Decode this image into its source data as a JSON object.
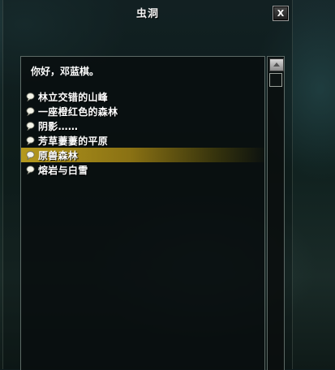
{
  "window": {
    "title": "虫洞",
    "close_label": "X"
  },
  "dialog": {
    "greeting": "你好，邓蓝棋。",
    "options": [
      {
        "label": "林立交错的山峰",
        "icon": "speech-bubble-icon",
        "selected": false
      },
      {
        "label": "一座橙红色的森林",
        "icon": "speech-bubble-icon",
        "selected": false
      },
      {
        "label": "阴影……",
        "icon": "speech-bubble-icon",
        "selected": false
      },
      {
        "label": "芳草萋萋的平原",
        "icon": "speech-bubble-icon",
        "selected": false
      },
      {
        "label": "原兽森林",
        "icon": "speech-bubble-icon",
        "selected": true
      },
      {
        "label": "熔岩与白雪",
        "icon": "speech-bubble-icon",
        "selected": false
      }
    ]
  },
  "colors": {
    "highlight": "#bea01e",
    "text": "#ffffff",
    "panel_border": "#5d6a66"
  }
}
